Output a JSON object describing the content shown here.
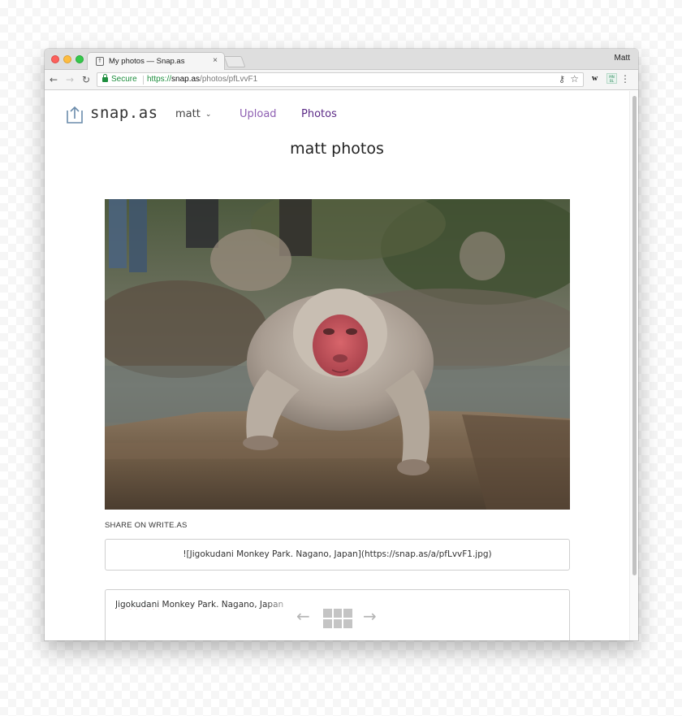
{
  "browser": {
    "tab_title": "My photos — Snap.as",
    "tab_close": "×",
    "profile_name": "Matt",
    "secure_label": "Secure",
    "url_scheme": "https://",
    "url_host": "snap.as",
    "url_path": "/photos/pfLvvF1",
    "extension_letter": "w",
    "extension_badge": "MN BL",
    "icons": [
      "back-arrow-icon",
      "forward-arrow-icon",
      "reload-icon",
      "lock-icon",
      "key-icon",
      "star-icon",
      "menu-icon"
    ]
  },
  "site": {
    "brand": "snap.as",
    "user_menu": "matt",
    "nav": {
      "upload": "Upload",
      "photos": "Photos"
    },
    "colors": {
      "link": "#8e5fb2",
      "active_link": "#5b2a86"
    }
  },
  "main": {
    "title": "matt photos",
    "photo_subject": "snow monkey bathing in hot spring",
    "share_label": "SHARE ON WRITE.AS",
    "share_markdown": "![Jigokudani Monkey Park. Nagano, Japan](https://snap.as/a/pfLvvF1.jpg)",
    "caption_word_1": "Jigokudani",
    "caption_rest": " Monkey Park. Nagano, Japan",
    "pager": {
      "prev": "←",
      "next": "→"
    }
  }
}
